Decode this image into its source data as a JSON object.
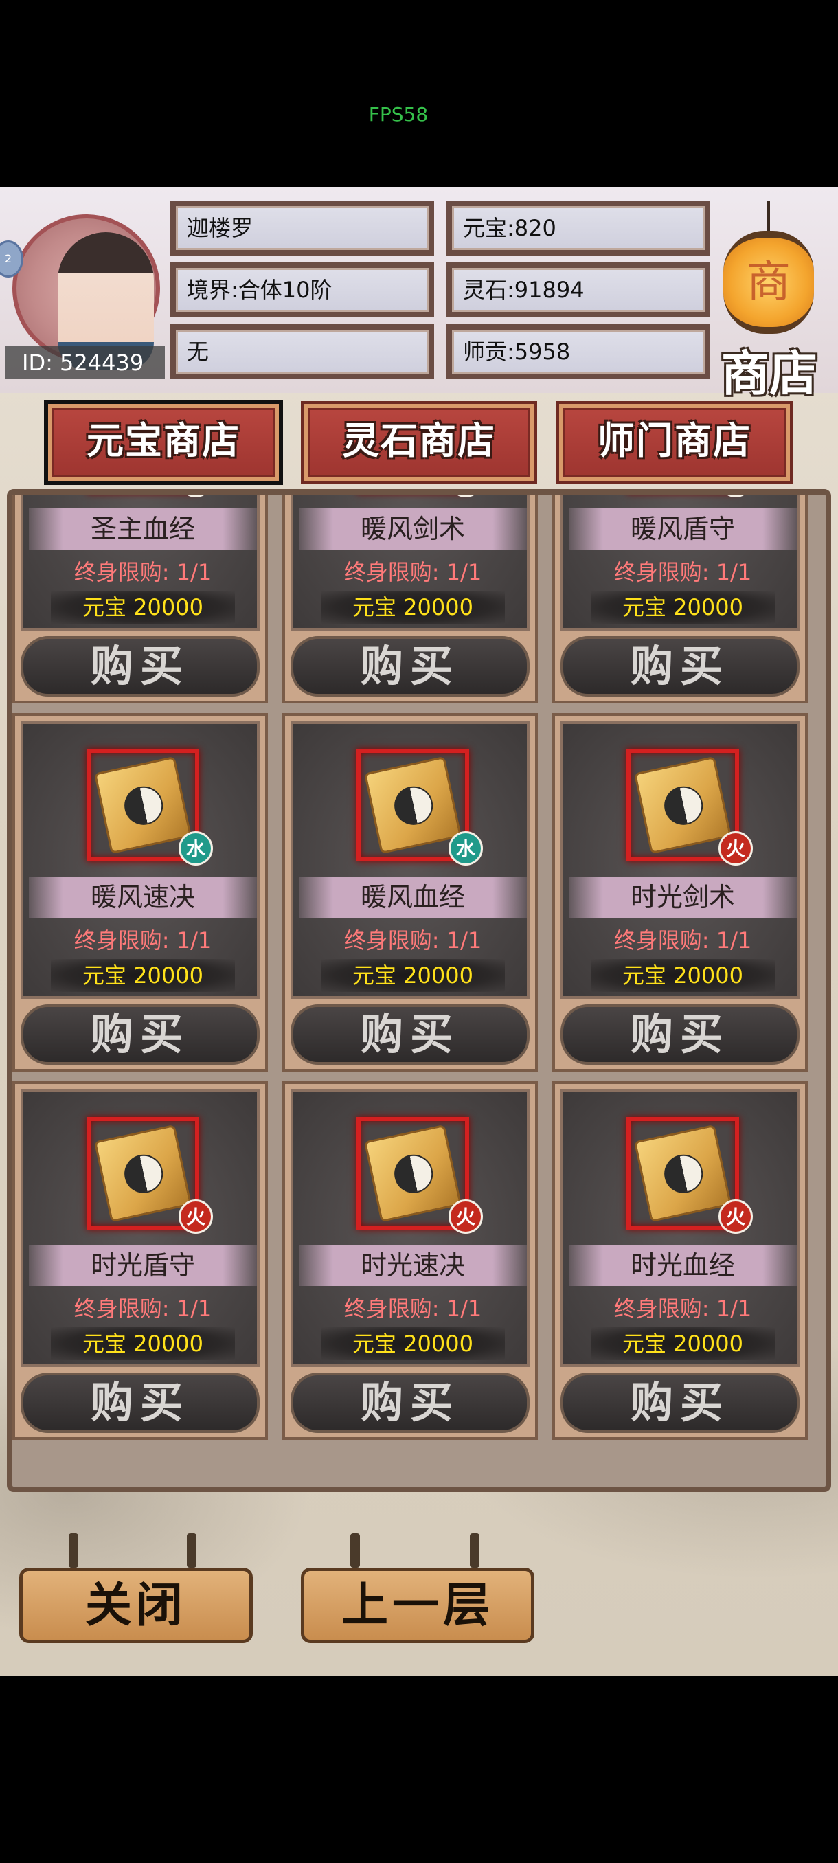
{
  "fps": "FPS58",
  "player": {
    "id": "ID: 524439",
    "badge": "2",
    "name": "迦楼罗",
    "realm": "境界:合体10阶",
    "sect": "无",
    "yuanbao": "元宝:820",
    "lingshi": "灵石:91894",
    "shigong": "师贡:5958"
  },
  "shop_sign": "商店",
  "lantern_char": "商",
  "tabs": [
    "元宝商店",
    "灵石商店",
    "师门商店"
  ],
  "items": [
    {
      "name": "圣主血经",
      "element": "土",
      "limit": "终身限购: 1/1",
      "price": "元宝 20000",
      "buy": "购买"
    },
    {
      "name": "暖风剑术",
      "element": "水",
      "limit": "终身限购: 1/1",
      "price": "元宝 20000",
      "buy": "购买"
    },
    {
      "name": "暖风盾守",
      "element": "水",
      "limit": "终身限购: 1/1",
      "price": "元宝 20000",
      "buy": "购买"
    },
    {
      "name": "暖风速决",
      "element": "水",
      "limit": "终身限购: 1/1",
      "price": "元宝 20000",
      "buy": "购买"
    },
    {
      "name": "暖风血经",
      "element": "水",
      "limit": "终身限购: 1/1",
      "price": "元宝 20000",
      "buy": "购买"
    },
    {
      "name": "时光剑术",
      "element": "火",
      "limit": "终身限购: 1/1",
      "price": "元宝 20000",
      "buy": "购买"
    },
    {
      "name": "时光盾守",
      "element": "火",
      "limit": "终身限购: 1/1",
      "price": "元宝 20000",
      "buy": "购买"
    },
    {
      "name": "时光速决",
      "element": "火",
      "limit": "终身限购: 1/1",
      "price": "元宝 20000",
      "buy": "购买"
    },
    {
      "name": "时光血经",
      "element": "火",
      "limit": "终身限购: 1/1",
      "price": "元宝 20000",
      "buy": "购买"
    }
  ],
  "bottom": {
    "close": "关闭",
    "back": "上一层"
  }
}
